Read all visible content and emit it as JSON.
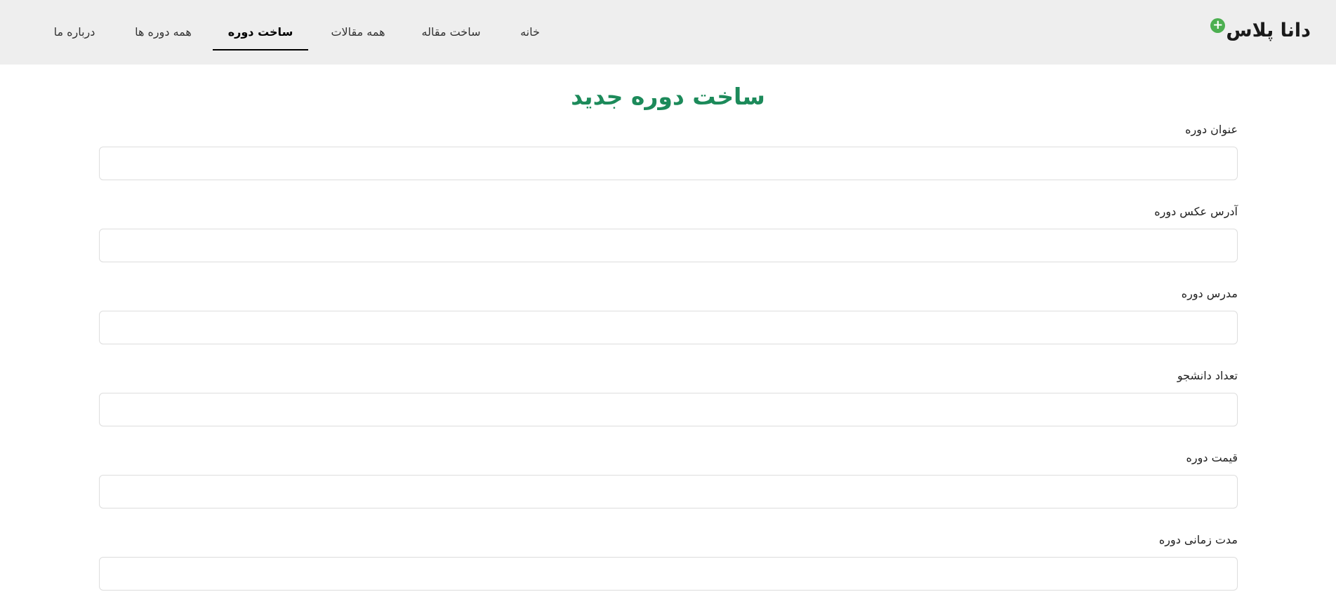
{
  "brand": {
    "name": "دانا پلاس",
    "icon": "plus-circle-icon",
    "icon_glyph": "+",
    "icon_color": "#4caf50"
  },
  "nav": {
    "home": "خانه",
    "new_article": "ساخت مقاله",
    "all_articles": "همه مقالات",
    "new_course": "ساخت دوره",
    "all_courses": "همه دوره ها",
    "about": "درباره ما",
    "active": "ساخت دوره"
  },
  "page": {
    "title": "ساخت دوره جدید",
    "title_color": "#1c8a5a"
  },
  "form": {
    "fields": [
      {
        "label": "عنوان دوره",
        "value": ""
      },
      {
        "label": "آدرس عکس دوره",
        "value": ""
      },
      {
        "label": "مدرس دوره",
        "value": ""
      },
      {
        "label": "تعداد دانشجو",
        "value": ""
      },
      {
        "label": "قیمت دوره",
        "value": ""
      },
      {
        "label": "مدت زمانی دوره",
        "value": ""
      }
    ]
  }
}
